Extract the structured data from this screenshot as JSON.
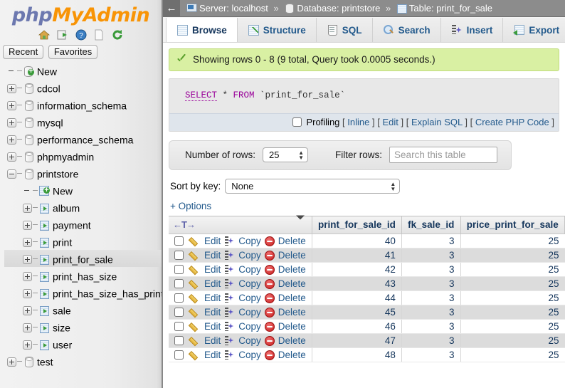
{
  "app": {
    "logo_php": "php",
    "logo_my": "My",
    "logo_admin": "Admin"
  },
  "sidebar": {
    "quick_icons": [
      {
        "name": "home-icon",
        "title": "Home"
      },
      {
        "name": "logout-icon",
        "title": "Log out"
      },
      {
        "name": "help-icon",
        "title": "phpMyAdmin documentation"
      },
      {
        "name": "docs-icon",
        "title": "Documentation"
      },
      {
        "name": "reload-icon",
        "title": "Reload navigation"
      }
    ],
    "pills": [
      {
        "label": "Recent"
      },
      {
        "label": "Favorites"
      }
    ],
    "tree": [
      {
        "label": "New",
        "type": "new-db",
        "depth": 0,
        "expander": "none",
        "selected": false
      },
      {
        "label": "cdcol",
        "type": "db",
        "depth": 0,
        "expander": "plus",
        "selected": false
      },
      {
        "label": "information_schema",
        "type": "db",
        "depth": 0,
        "expander": "plus",
        "selected": false
      },
      {
        "label": "mysql",
        "type": "db",
        "depth": 0,
        "expander": "plus",
        "selected": false
      },
      {
        "label": "performance_schema",
        "type": "db",
        "depth": 0,
        "expander": "plus",
        "selected": false
      },
      {
        "label": "phpmyadmin",
        "type": "db",
        "depth": 0,
        "expander": "plus",
        "selected": false
      },
      {
        "label": "printstore",
        "type": "db",
        "depth": 0,
        "expander": "minus",
        "selected": false
      },
      {
        "label": "New",
        "type": "new-table",
        "depth": 1,
        "expander": "none",
        "selected": false
      },
      {
        "label": "album",
        "type": "table",
        "depth": 1,
        "expander": "plus",
        "selected": false
      },
      {
        "label": "payment",
        "type": "table",
        "depth": 1,
        "expander": "plus",
        "selected": false
      },
      {
        "label": "print",
        "type": "table",
        "depth": 1,
        "expander": "plus",
        "selected": false
      },
      {
        "label": "print_for_sale",
        "type": "table",
        "depth": 1,
        "expander": "plus",
        "selected": true
      },
      {
        "label": "print_has_size",
        "type": "table",
        "depth": 1,
        "expander": "plus",
        "selected": false
      },
      {
        "label": "print_has_size_has_print_for_",
        "type": "table",
        "depth": 1,
        "expander": "plus",
        "selected": false
      },
      {
        "label": "sale",
        "type": "table",
        "depth": 1,
        "expander": "plus",
        "selected": false
      },
      {
        "label": "size",
        "type": "table",
        "depth": 1,
        "expander": "plus",
        "selected": false
      },
      {
        "label": "user",
        "type": "table",
        "depth": 1,
        "expander": "plus",
        "selected": false
      },
      {
        "label": "test",
        "type": "db",
        "depth": 0,
        "expander": "plus",
        "selected": false
      }
    ]
  },
  "breadcrumb": {
    "back_glyph": "←",
    "server": "Server: localhost",
    "database": "Database: printstore",
    "table": "Table: print_for_sale",
    "separator": "»"
  },
  "tabs": [
    {
      "label": "Browse",
      "icon": "browse-icon",
      "active": true
    },
    {
      "label": "Structure",
      "icon": "structure-icon",
      "active": false
    },
    {
      "label": "SQL",
      "icon": "sql-icon",
      "active": false
    },
    {
      "label": "Search",
      "icon": "search-icon",
      "active": false
    },
    {
      "label": "Insert",
      "icon": "insert-icon",
      "active": false
    },
    {
      "label": "Export",
      "icon": "export-icon",
      "active": false
    }
  ],
  "notice": {
    "text": "Showing rows 0 - 8 (9 total, Query took 0.0005 seconds.)"
  },
  "sql": {
    "keyword_select": "SELECT",
    "star": " * ",
    "keyword_from": "FROM",
    "table_ref": " `print_for_sale`",
    "profiling_label": "Profiling",
    "links": [
      "Inline",
      "Edit",
      "Explain SQL",
      "Create PHP Code"
    ],
    "bracket_open": "[",
    "bracket_close": "]"
  },
  "controls": {
    "num_rows_label": "Number of rows:",
    "num_rows_value": "25",
    "filter_label": "Filter rows:",
    "filter_placeholder": "Search this table",
    "filter_value": "",
    "sort_label": "Sort by key:",
    "sort_value": "None",
    "options_label": "+ Options"
  },
  "table": {
    "action_header_glyph": "←T→",
    "columns": [
      "print_for_sale_id",
      "fk_sale_id",
      "price_print_for_sale"
    ],
    "row_actions": {
      "edit": "Edit",
      "copy": "Copy",
      "delete": "Delete"
    },
    "rows": [
      {
        "print_for_sale_id": "40",
        "fk_sale_id": "3",
        "price_print_for_sale": "25"
      },
      {
        "print_for_sale_id": "41",
        "fk_sale_id": "3",
        "price_print_for_sale": "25"
      },
      {
        "print_for_sale_id": "42",
        "fk_sale_id": "3",
        "price_print_for_sale": "25"
      },
      {
        "print_for_sale_id": "43",
        "fk_sale_id": "3",
        "price_print_for_sale": "25"
      },
      {
        "print_for_sale_id": "44",
        "fk_sale_id": "3",
        "price_print_for_sale": "25"
      },
      {
        "print_for_sale_id": "45",
        "fk_sale_id": "3",
        "price_print_for_sale": "25"
      },
      {
        "print_for_sale_id": "46",
        "fk_sale_id": "3",
        "price_print_for_sale": "25"
      },
      {
        "print_for_sale_id": "47",
        "fk_sale_id": "3",
        "price_print_for_sale": "25"
      },
      {
        "print_for_sale_id": "48",
        "fk_sale_id": "3",
        "price_print_for_sale": "25"
      }
    ]
  },
  "colors": {
    "notice_bg": "#d9f0a3",
    "tab_link": "#235a8c",
    "breadcrumb_bg": "#8c8c8c",
    "logo_orange": "#f89406",
    "logo_blue": "#6c78af",
    "row_even_bg": "#dcdcdc"
  }
}
